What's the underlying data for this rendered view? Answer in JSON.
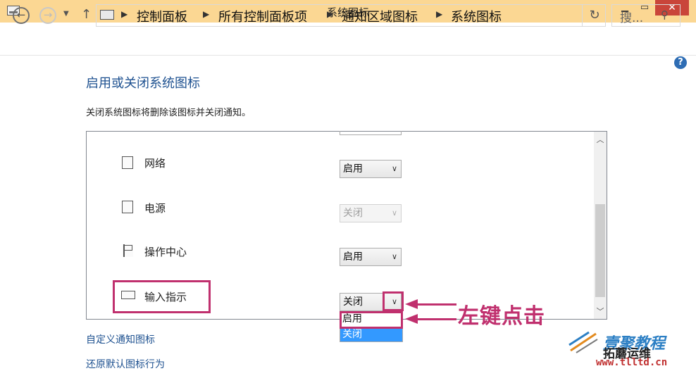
{
  "window": {
    "title": "系统图标",
    "controls": {
      "minimize": "▁",
      "maximize": "▭",
      "close": "✕"
    }
  },
  "nav": {
    "back_icon": "arrow-left-icon",
    "forward_icon": "arrow-right-icon",
    "breadcrumbs": [
      "控制面板",
      "所有控制面板项",
      "通知区域图标",
      "系统图标"
    ],
    "search_placeholder": "搜...",
    "refresh_glyph": "↻",
    "search_glyph": "⚲"
  },
  "help_glyph": "?",
  "page": {
    "title": "启用或关闭系统图标",
    "description": "关闭系统图标将删除该图标并关闭通知。"
  },
  "icons_list": [
    {
      "name": "网络",
      "icon": "network-icon",
      "value": "启用",
      "disabled": false
    },
    {
      "name": "电源",
      "icon": "power-icon",
      "value": "关闭",
      "disabled": true
    },
    {
      "name": "操作中心",
      "icon": "flag-icon",
      "value": "启用",
      "disabled": false
    },
    {
      "name": "输入指示",
      "icon": "keyboard-icon",
      "value": "关闭",
      "disabled": false
    }
  ],
  "dropdown_options": [
    {
      "label": "启用",
      "highlighted": false
    },
    {
      "label": "关闭",
      "highlighted": true
    }
  ],
  "annotation": {
    "text": "左键点击",
    "color": "#c0306e"
  },
  "links": {
    "customize": "自定义通知图标",
    "restore": "还原默认图标行为"
  },
  "watermark": {
    "name": "壹聚教程",
    "sub": "拓蘑运维",
    "url": "www.tlltd.cn"
  },
  "colors": {
    "titlebar": "#fbd793",
    "accent_text": "#1e5190",
    "selection": "#3399ff"
  }
}
